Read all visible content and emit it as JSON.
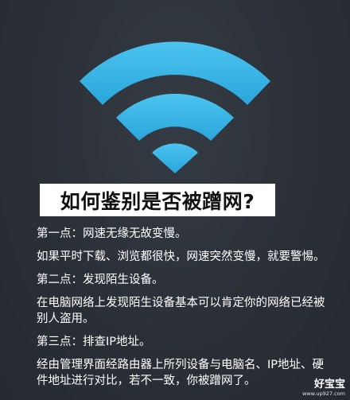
{
  "title": "如何鉴别是否被蹭网?",
  "icon": {
    "name": "wifi-icon",
    "color": "#3fb6e6"
  },
  "sections": [
    {
      "kind": "heading",
      "text": "第一点：网速无缘无故变慢。"
    },
    {
      "kind": "body",
      "text": "如果平时下载、浏览都很快，网速突然变慢，就要警惕。"
    },
    {
      "kind": "heading",
      "text": "第二点：发现陌生设备。"
    },
    {
      "kind": "body",
      "text": "在电脑网络上发现陌生设备基本可以肯定你的网络已经被别人盗用。"
    },
    {
      "kind": "heading",
      "text": "第三点：排查IP地址。"
    },
    {
      "kind": "body",
      "text": "经由管理界面经路由器上所列设备与电脑名、IP地址、硬件地址进行对比，若不一致，你被蹭网了。"
    }
  ],
  "watermark": {
    "name": "好宝宝",
    "url": "www.up927.com"
  }
}
